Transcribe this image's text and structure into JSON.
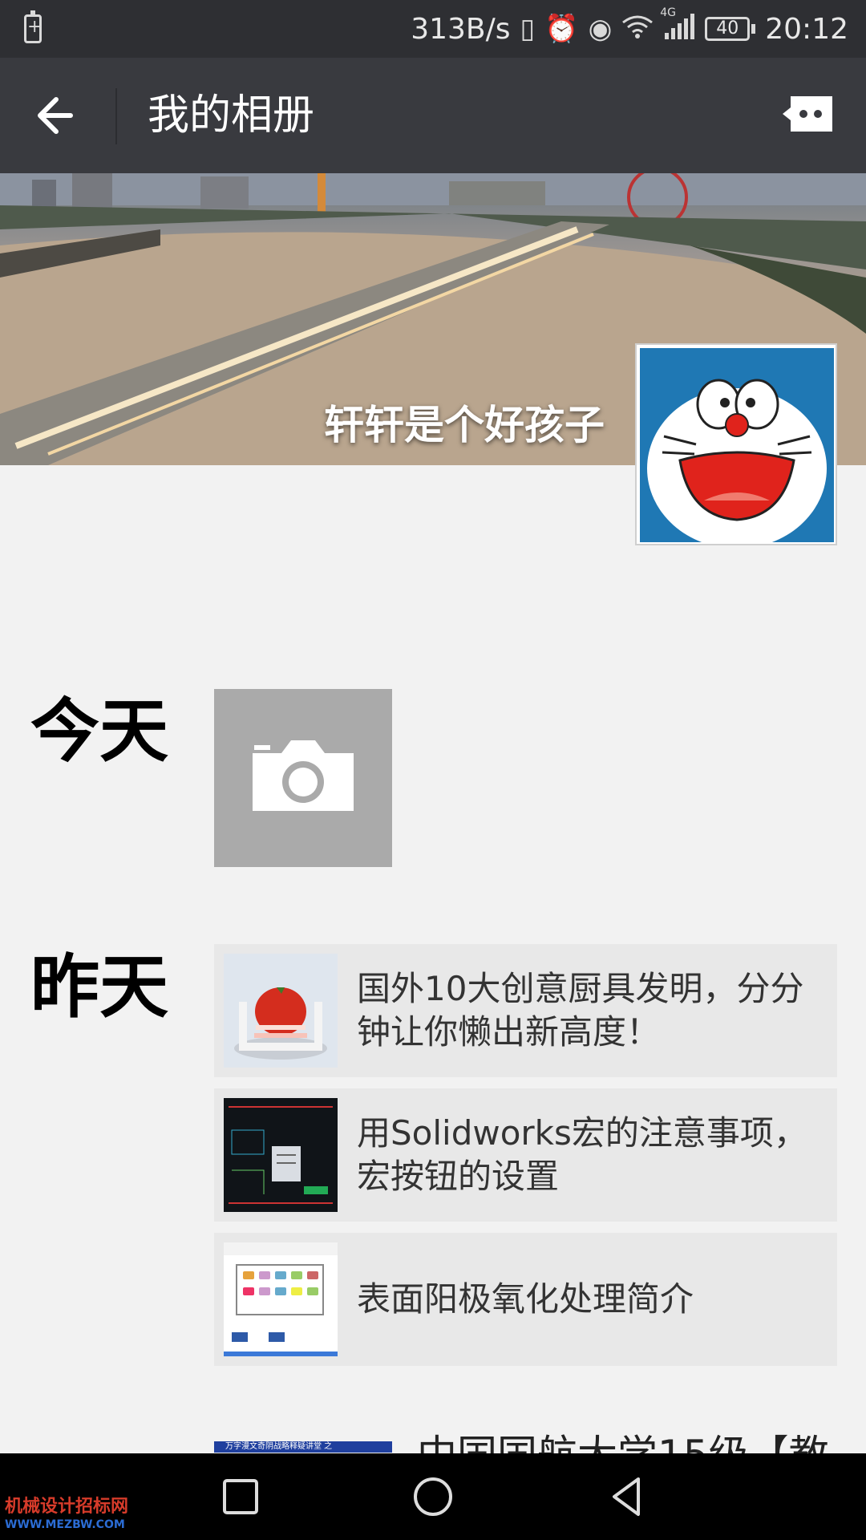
{
  "status_bar": {
    "net_speed": "313B/s",
    "network_type": "4G",
    "battery_level": "40",
    "time": "20:12"
  },
  "title_bar": {
    "title": "我的相册"
  },
  "profile": {
    "nickname": "轩轩是个好孩子"
  },
  "timeline": [
    {
      "day": "今天",
      "items": []
    },
    {
      "day": "昨天",
      "items": [
        {
          "title": "国外10大创意厨具发明，分分钟让你懒出新高度！"
        },
        {
          "title": "用Solidworks宏的注意事项，宏按钮的设置"
        },
        {
          "title": "表面阳极氧化处理简介"
        }
      ]
    }
  ],
  "partial_post": {
    "thumb_caption": "万字漫文奇阴战略释疑讲堂 之",
    "title_fragment": "中国国航大学15级【教"
  },
  "watermark": {
    "text": "机械设计招标网",
    "sub": "WWW.MEZBW.COM"
  },
  "colors": {
    "status_bar_bg": "#2e2f33",
    "title_bar_bg": "#393a3f",
    "page_bg": "#f2f2f2",
    "post_bg": "#e8e8e8",
    "camera_tile_bg": "#aaaaaa"
  }
}
